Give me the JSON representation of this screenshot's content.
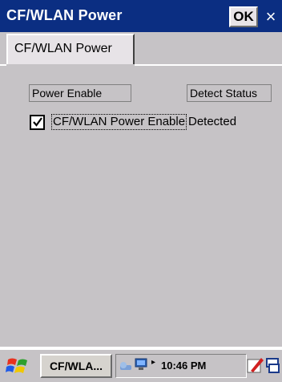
{
  "window": {
    "title": "CF/WLAN Power",
    "ok_label": "OK",
    "close_label": "×"
  },
  "tabs": [
    {
      "label": "CF/WLAN Power"
    }
  ],
  "columns": {
    "power_header": "Power Enable",
    "status_header": "Detect Status"
  },
  "row": {
    "checkbox_label": "CF/WLAN Power Enable",
    "checked": true,
    "status": "Detected"
  },
  "taskbar": {
    "task_label": "CF/WLA...",
    "clock": "10:46 PM",
    "tray_arrow": "▸"
  },
  "colors": {
    "titlebar": "#0b2e82",
    "background": "#c6c3c6"
  }
}
